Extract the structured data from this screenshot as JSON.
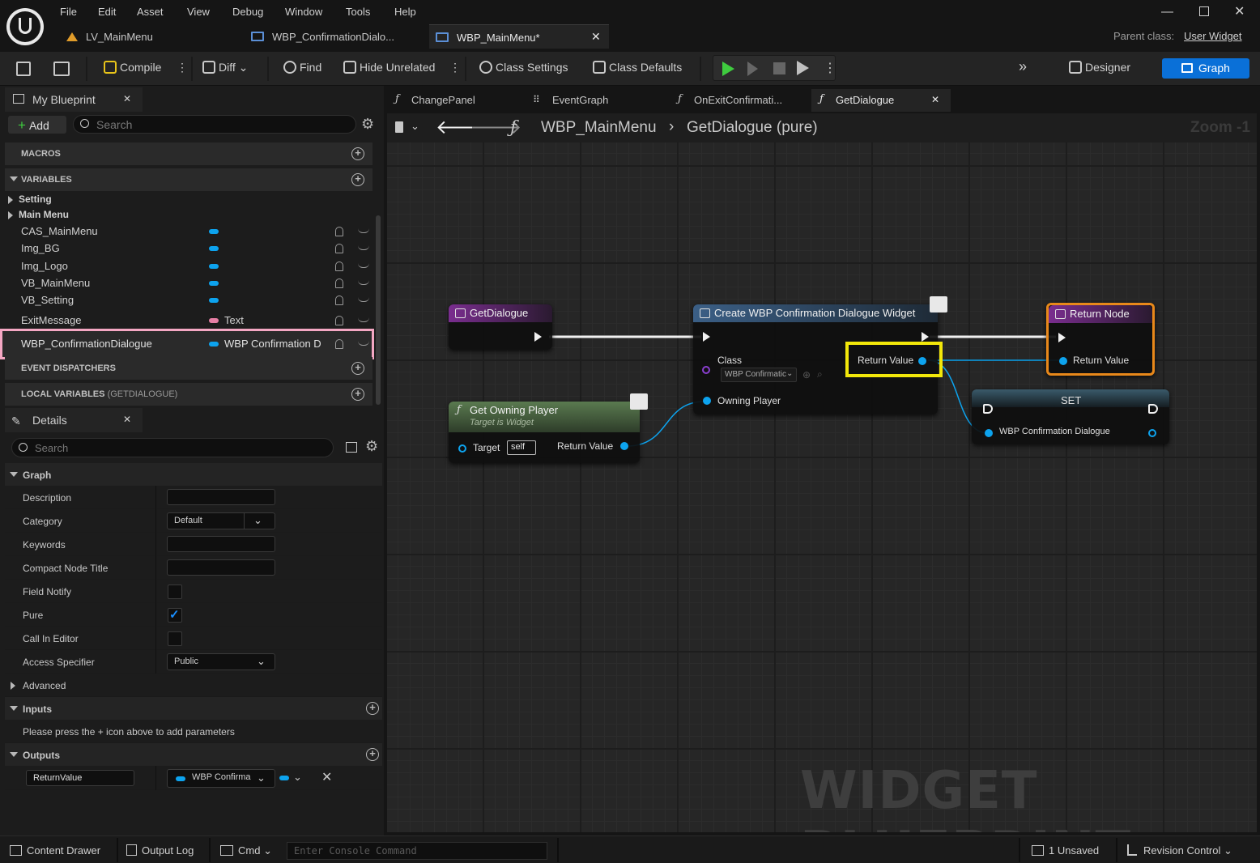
{
  "menu": [
    "File",
    "Edit",
    "Asset",
    "View",
    "Debug",
    "Window",
    "Tools",
    "Help"
  ],
  "doc_tabs": [
    {
      "label": "LV_MainMenu"
    },
    {
      "label": "WBP_ConfirmationDialo..."
    },
    {
      "label": "WBP_MainMenu*"
    }
  ],
  "parent_class": {
    "label": "Parent class:",
    "value": "User Widget"
  },
  "toolbar": {
    "compile": "Compile",
    "diff": "Diff",
    "find": "Find",
    "hide_unrelated": "Hide Unrelated",
    "class_settings": "Class Settings",
    "class_defaults": "Class Defaults",
    "designer": "Designer",
    "graph": "Graph"
  },
  "my_blueprint": {
    "tab": "My Blueprint",
    "add": "Add",
    "search_placeholder": "Search",
    "macros": "MACROS",
    "variables": "VARIABLES",
    "categories": [
      "Setting",
      "Main Menu"
    ],
    "vars": [
      {
        "name": "CAS_MainMenu",
        "type": ""
      },
      {
        "name": "Img_BG",
        "type": ""
      },
      {
        "name": "Img_Logo",
        "type": ""
      },
      {
        "name": "VB_MainMenu",
        "type": ""
      },
      {
        "name": "VB_Setting",
        "type": ""
      },
      {
        "name": "ExitMessage",
        "type": "Text"
      },
      {
        "name": "WBP_ConfirmationDialogue",
        "type": "WBP Confirmation D"
      }
    ],
    "event_dispatchers": "EVENT DISPATCHERS",
    "local_variables": "LOCAL VARIABLES",
    "local_variables_scope": "(GETDIALOGUE)"
  },
  "details": {
    "tab": "Details",
    "search_placeholder": "Search",
    "graph_section": "Graph",
    "rows": {
      "description": "Description",
      "category": "Category",
      "category_value": "Default",
      "keywords": "Keywords",
      "compact_node_title": "Compact Node Title",
      "field_notify": "Field Notify",
      "pure": "Pure",
      "call_in_editor": "Call In Editor",
      "access_specifier": "Access Specifier",
      "access_specifier_value": "Public"
    },
    "advanced": "Advanced",
    "inputs": "Inputs",
    "inputs_hint": "Please press the + icon above to add parameters",
    "outputs": "Outputs",
    "output_name": "ReturnValue",
    "output_type": "WBP Confirma"
  },
  "graph_tabs": [
    "ChangePanel",
    "EventGraph",
    "OnExitConfirmati...",
    "GetDialogue"
  ],
  "breadcrumb": {
    "root": "WBP_MainMenu",
    "current": "GetDialogue (pure)",
    "zoom": "Zoom -1"
  },
  "nodes": {
    "entry": {
      "title": "GetDialogue"
    },
    "create": {
      "title": "Create WBP Confirmation Dialogue Widget",
      "class_label": "Class",
      "class_value": "WBP Confirmatic",
      "return_value": "Return Value",
      "owning_player": "Owning Player"
    },
    "owning": {
      "title": "Get Owning Player",
      "subtitle": "Target is Widget",
      "target": "Target",
      "self": "self",
      "return_value": "Return Value"
    },
    "return": {
      "title": "Return Node",
      "return_value": "Return Value"
    },
    "set": {
      "title": "SET",
      "var": "WBP Confirmation Dialogue"
    }
  },
  "watermark": "WIDGET BLUEPRINT",
  "statusbar": {
    "content_drawer": "Content Drawer",
    "output_log": "Output Log",
    "cmd": "Cmd",
    "console_placeholder": "Enter Console Command",
    "unsaved": "1 Unsaved",
    "revision_control": "Revision Control"
  },
  "colors": {
    "accent": "#0a70d8",
    "pin_object": "#0da3ee",
    "pin_text": "#e77fa5",
    "highlight_pink": "#f4a7c3",
    "highlight_yellow": "#f2e70a",
    "return_border": "#e8881a",
    "play_green": "#3fcc3f"
  }
}
